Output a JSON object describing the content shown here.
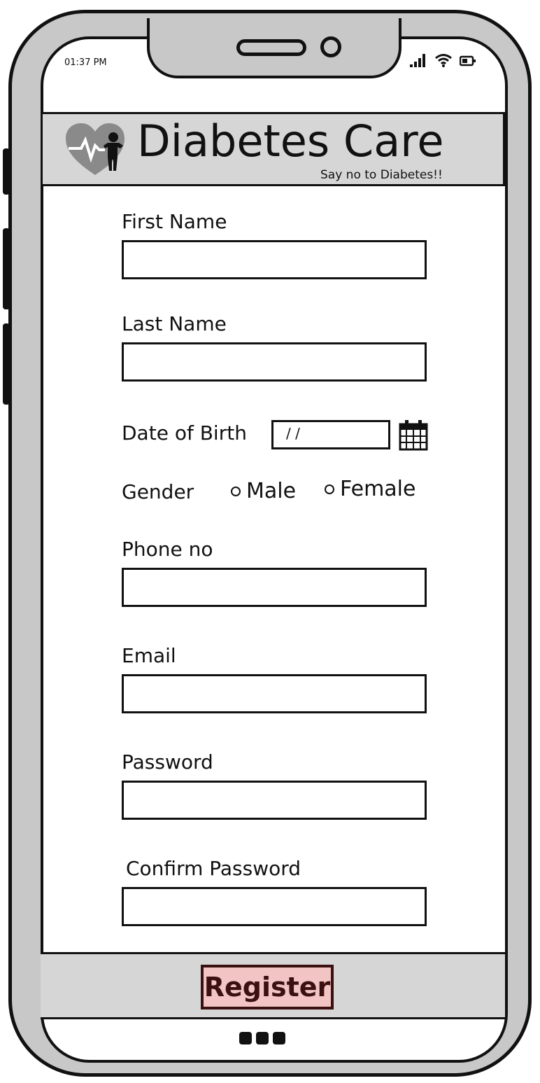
{
  "status_bar": {
    "time": "01:37 PM"
  },
  "header": {
    "title": "Diabetes Care",
    "tagline": "Say no to Diabetes!!"
  },
  "form": {
    "first_name_label": "First Name",
    "last_name_label": "Last Name",
    "dob_label": "Date of Birth",
    "dob_value": "/ /",
    "gender_label": "Gender",
    "gender_options": [
      "Male",
      "Female"
    ],
    "phone_label": "Phone no",
    "email_label": "Email",
    "password_label": "Password",
    "confirm_password_label": "Confirm Password"
  },
  "footer": {
    "register_label": "Register"
  },
  "colors": {
    "frame": "#c8c8c8",
    "header_bg": "#d6d6d6",
    "button_bg": "#f2c4c4",
    "button_text": "#3b1010"
  }
}
